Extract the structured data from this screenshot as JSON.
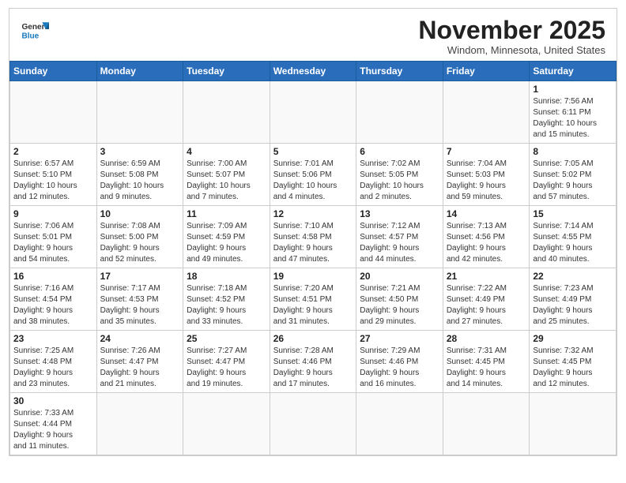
{
  "header": {
    "logo_general": "General",
    "logo_blue": "Blue",
    "month_title": "November 2025",
    "subtitle": "Windom, Minnesota, United States"
  },
  "days_of_week": [
    "Sunday",
    "Monday",
    "Tuesday",
    "Wednesday",
    "Thursday",
    "Friday",
    "Saturday"
  ],
  "weeks": [
    [
      {
        "day": "",
        "info": ""
      },
      {
        "day": "",
        "info": ""
      },
      {
        "day": "",
        "info": ""
      },
      {
        "day": "",
        "info": ""
      },
      {
        "day": "",
        "info": ""
      },
      {
        "day": "",
        "info": ""
      },
      {
        "day": "1",
        "info": "Sunrise: 7:56 AM\nSunset: 6:11 PM\nDaylight: 10 hours\nand 15 minutes."
      }
    ],
    [
      {
        "day": "2",
        "info": "Sunrise: 6:57 AM\nSunset: 5:10 PM\nDaylight: 10 hours\nand 12 minutes."
      },
      {
        "day": "3",
        "info": "Sunrise: 6:59 AM\nSunset: 5:08 PM\nDaylight: 10 hours\nand 9 minutes."
      },
      {
        "day": "4",
        "info": "Sunrise: 7:00 AM\nSunset: 5:07 PM\nDaylight: 10 hours\nand 7 minutes."
      },
      {
        "day": "5",
        "info": "Sunrise: 7:01 AM\nSunset: 5:06 PM\nDaylight: 10 hours\nand 4 minutes."
      },
      {
        "day": "6",
        "info": "Sunrise: 7:02 AM\nSunset: 5:05 PM\nDaylight: 10 hours\nand 2 minutes."
      },
      {
        "day": "7",
        "info": "Sunrise: 7:04 AM\nSunset: 5:03 PM\nDaylight: 9 hours\nand 59 minutes."
      },
      {
        "day": "8",
        "info": "Sunrise: 7:05 AM\nSunset: 5:02 PM\nDaylight: 9 hours\nand 57 minutes."
      }
    ],
    [
      {
        "day": "9",
        "info": "Sunrise: 7:06 AM\nSunset: 5:01 PM\nDaylight: 9 hours\nand 54 minutes."
      },
      {
        "day": "10",
        "info": "Sunrise: 7:08 AM\nSunset: 5:00 PM\nDaylight: 9 hours\nand 52 minutes."
      },
      {
        "day": "11",
        "info": "Sunrise: 7:09 AM\nSunset: 4:59 PM\nDaylight: 9 hours\nand 49 minutes."
      },
      {
        "day": "12",
        "info": "Sunrise: 7:10 AM\nSunset: 4:58 PM\nDaylight: 9 hours\nand 47 minutes."
      },
      {
        "day": "13",
        "info": "Sunrise: 7:12 AM\nSunset: 4:57 PM\nDaylight: 9 hours\nand 44 minutes."
      },
      {
        "day": "14",
        "info": "Sunrise: 7:13 AM\nSunset: 4:56 PM\nDaylight: 9 hours\nand 42 minutes."
      },
      {
        "day": "15",
        "info": "Sunrise: 7:14 AM\nSunset: 4:55 PM\nDaylight: 9 hours\nand 40 minutes."
      }
    ],
    [
      {
        "day": "16",
        "info": "Sunrise: 7:16 AM\nSunset: 4:54 PM\nDaylight: 9 hours\nand 38 minutes."
      },
      {
        "day": "17",
        "info": "Sunrise: 7:17 AM\nSunset: 4:53 PM\nDaylight: 9 hours\nand 35 minutes."
      },
      {
        "day": "18",
        "info": "Sunrise: 7:18 AM\nSunset: 4:52 PM\nDaylight: 9 hours\nand 33 minutes."
      },
      {
        "day": "19",
        "info": "Sunrise: 7:20 AM\nSunset: 4:51 PM\nDaylight: 9 hours\nand 31 minutes."
      },
      {
        "day": "20",
        "info": "Sunrise: 7:21 AM\nSunset: 4:50 PM\nDaylight: 9 hours\nand 29 minutes."
      },
      {
        "day": "21",
        "info": "Sunrise: 7:22 AM\nSunset: 4:49 PM\nDaylight: 9 hours\nand 27 minutes."
      },
      {
        "day": "22",
        "info": "Sunrise: 7:23 AM\nSunset: 4:49 PM\nDaylight: 9 hours\nand 25 minutes."
      }
    ],
    [
      {
        "day": "23",
        "info": "Sunrise: 7:25 AM\nSunset: 4:48 PM\nDaylight: 9 hours\nand 23 minutes."
      },
      {
        "day": "24",
        "info": "Sunrise: 7:26 AM\nSunset: 4:47 PM\nDaylight: 9 hours\nand 21 minutes."
      },
      {
        "day": "25",
        "info": "Sunrise: 7:27 AM\nSunset: 4:47 PM\nDaylight: 9 hours\nand 19 minutes."
      },
      {
        "day": "26",
        "info": "Sunrise: 7:28 AM\nSunset: 4:46 PM\nDaylight: 9 hours\nand 17 minutes."
      },
      {
        "day": "27",
        "info": "Sunrise: 7:29 AM\nSunset: 4:46 PM\nDaylight: 9 hours\nand 16 minutes."
      },
      {
        "day": "28",
        "info": "Sunrise: 7:31 AM\nSunset: 4:45 PM\nDaylight: 9 hours\nand 14 minutes."
      },
      {
        "day": "29",
        "info": "Sunrise: 7:32 AM\nSunset: 4:45 PM\nDaylight: 9 hours\nand 12 minutes."
      }
    ],
    [
      {
        "day": "30",
        "info": "Sunrise: 7:33 AM\nSunset: 4:44 PM\nDaylight: 9 hours\nand 11 minutes."
      },
      {
        "day": "",
        "info": ""
      },
      {
        "day": "",
        "info": ""
      },
      {
        "day": "",
        "info": ""
      },
      {
        "day": "",
        "info": ""
      },
      {
        "day": "",
        "info": ""
      },
      {
        "day": "",
        "info": ""
      }
    ]
  ]
}
